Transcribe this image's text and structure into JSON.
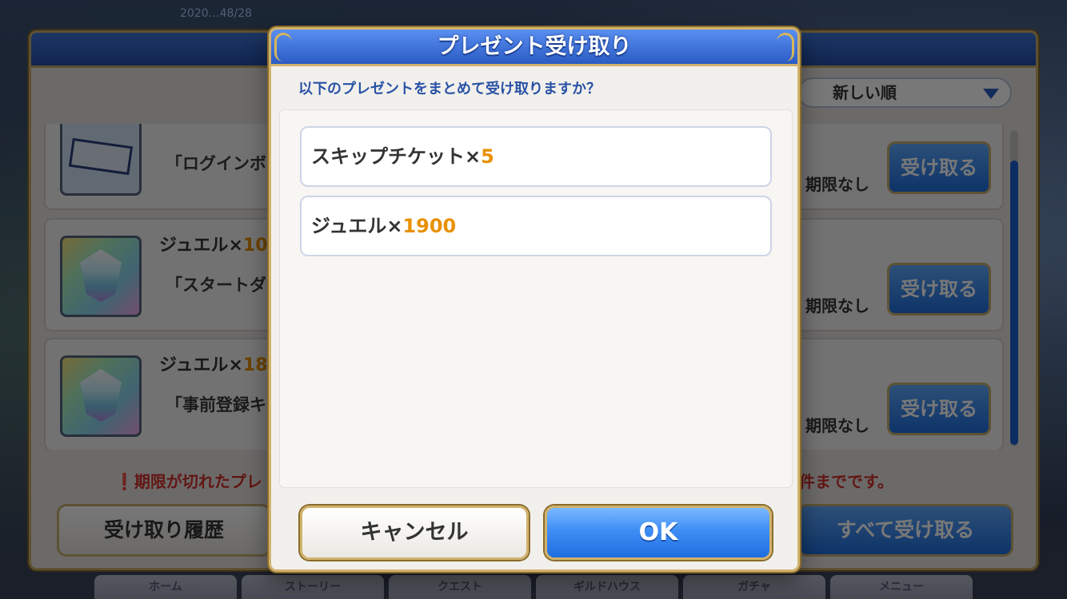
{
  "background": {
    "top_hint": "2020…48/28",
    "nav_items": [
      "ホーム",
      "ストーリー",
      "クエスト",
      "ギルドハウス",
      "ガチャ",
      "メニュー"
    ]
  },
  "present_box": {
    "sort_label": "新しい順",
    "rows": [
      {
        "title": "",
        "qty": "",
        "subtitle": "「ログインボ",
        "deadline": "期限なし",
        "button": "受け取る",
        "icon": "ticket"
      },
      {
        "title": "ジュエル×",
        "qty": "10",
        "subtitle": "「スタートダ",
        "deadline": "期限なし",
        "button": "受け取る",
        "icon": "jewel"
      },
      {
        "title": "ジュエル×",
        "qty": "18",
        "subtitle": "「事前登録キ",
        "deadline": "期限なし",
        "button": "受け取る",
        "icon": "jewel"
      }
    ],
    "warning_left": "期限が切れたプレ",
    "warning_right": "件までです。",
    "history_button": "受け取り履歴",
    "receive_all_button": "すべて受け取る"
  },
  "dialog": {
    "title": "プレゼント受け取り",
    "question": "以下のプレゼントをまとめて受け取りますか？",
    "items": [
      {
        "name": "スキップチケット×",
        "qty": "5"
      },
      {
        "name": "ジュエル×",
        "qty": "1900"
      }
    ],
    "cancel_label": "キャンセル",
    "ok_label": "OK"
  },
  "colors": {
    "dialog_header": "#2a5bc4",
    "gold_border": "#d1b26c",
    "quantity": "#e89100",
    "ok_button": "#1f6ee0",
    "warning": "#d0302c"
  }
}
